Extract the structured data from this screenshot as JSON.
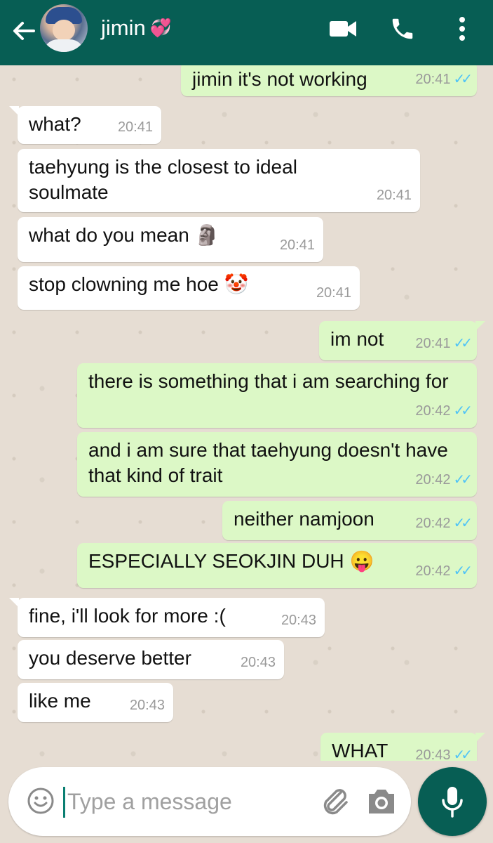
{
  "header": {
    "contact_name": "jimin",
    "contact_emoji": "💞",
    "back_icon": "arrow-left-icon",
    "video_icon": "video-camera-icon",
    "call_icon": "phone-icon",
    "menu_icon": "more-vertical-icon"
  },
  "messages": [
    {
      "dir": "out",
      "text": "jimin it's not working",
      "time": "20:41",
      "read": true
    },
    {
      "dir": "in",
      "text": "what?",
      "time": "20:41"
    },
    {
      "dir": "in",
      "text": "taehyung is the closest to ideal soulmate",
      "time": "20:41"
    },
    {
      "dir": "in",
      "text": "what do you mean",
      "emoji": "🗿",
      "time": "20:41"
    },
    {
      "dir": "in",
      "text": "stop clowning me hoe",
      "emoji": "🤡",
      "time": "20:41"
    },
    {
      "dir": "out",
      "text": "im not",
      "time": "20:41",
      "read": true
    },
    {
      "dir": "out",
      "text": "there is something that i am searching for",
      "time": "20:42",
      "read": true
    },
    {
      "dir": "out",
      "text": "and i am sure that taehyung doesn't have that kind of trait",
      "time": "20:42",
      "read": true
    },
    {
      "dir": "out",
      "text": "neither namjoon",
      "time": "20:42",
      "read": true
    },
    {
      "dir": "out",
      "text": "ESPECIALLY SEOKJIN DUH",
      "emoji": "😛",
      "time": "20:42",
      "read": true
    },
    {
      "dir": "in",
      "text": "fine, i'll look for more :(",
      "time": "20:43"
    },
    {
      "dir": "in",
      "text": "you deserve better",
      "time": "20:43"
    },
    {
      "dir": "in",
      "text": "like me",
      "time": "20:43"
    },
    {
      "dir": "out",
      "text": "WHAT",
      "time": "20:43",
      "read": true
    }
  ],
  "composer": {
    "placeholder": "Type a message",
    "emoji_icon": "smiley-icon",
    "attach_icon": "paperclip-icon",
    "camera_icon": "camera-icon",
    "mic_icon": "microphone-icon"
  },
  "colors": {
    "header": "#075e54",
    "outgoing_bubble": "#dcf8c6",
    "incoming_bubble": "#ffffff",
    "read_ticks": "#4fc3f7",
    "chat_background": "#e6ddd3"
  }
}
